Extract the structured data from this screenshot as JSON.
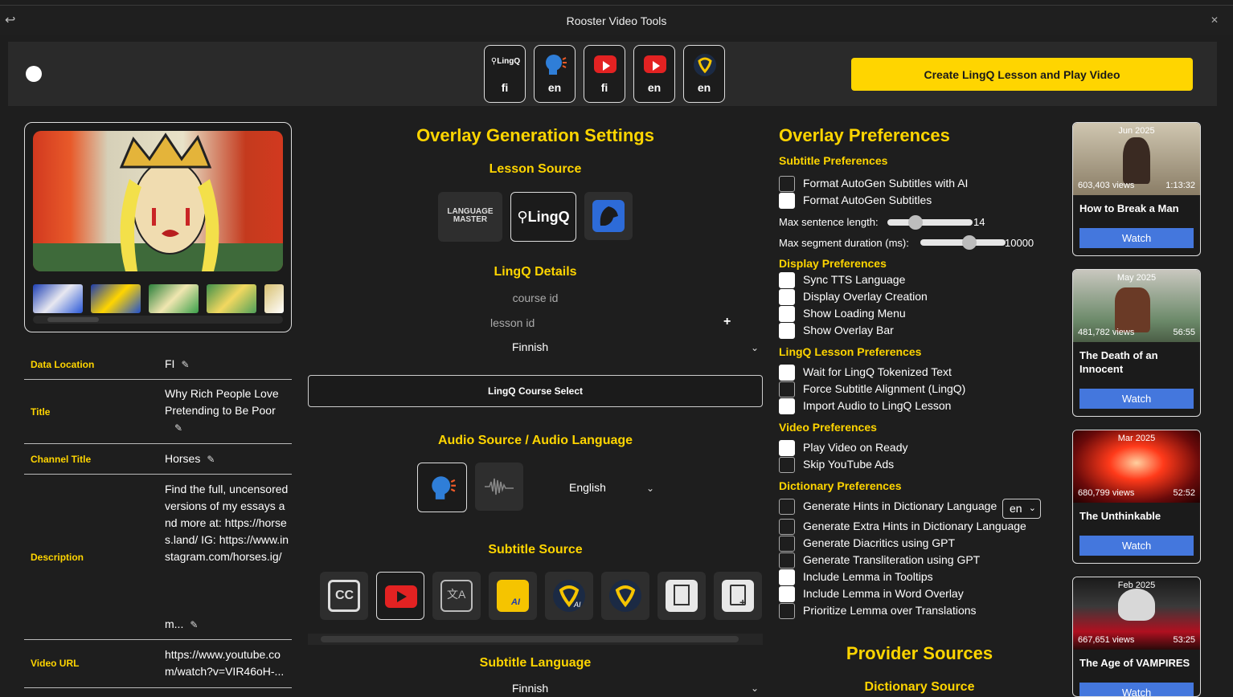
{
  "window": {
    "title": "Rooster Video Tools"
  },
  "topbar": {
    "langs": [
      {
        "icon": "lingq-logo-icon",
        "label": "fi"
      },
      {
        "icon": "speaking-head-icon",
        "label": "en"
      },
      {
        "icon": "youtube-icon",
        "label": "fi"
      },
      {
        "icon": "youtube-icon",
        "label": "en"
      },
      {
        "icon": "lingq-pin-icon",
        "label": "en"
      }
    ],
    "create_label": "Create LingQ Lesson and Play Video"
  },
  "info": {
    "data_location_k": "Data Location",
    "data_location_v": "FI",
    "title_k": "Title",
    "title_v": "Why Rich People Love Pretending to Be Poor",
    "channel_k": "Channel Title",
    "channel_v": "Horses",
    "desc_k": "Description",
    "desc_v": "Find the full, uncensored versions of my essays and more at: https://horses.land/ IG: https://www.instagram.com/horses.ig/",
    "desc_more": "m...",
    "url_k": "Video URL",
    "url_v": "https://www.youtube.com/watch?v=VIR46oH-..."
  },
  "center": {
    "heading": "Overlay Generation Settings",
    "lesson_source": "Lesson Source",
    "lm_label": "LANGUAGE MASTER",
    "lingq_label": "LingQ",
    "lingq_details": "LingQ Details",
    "course_id": "course id",
    "lesson_id": "lesson id",
    "plus": "+",
    "lesson_lang": "Finnish",
    "course_select": "LingQ Course Select",
    "audio_heading": "Audio Source / Audio Language",
    "audio_lang": "English",
    "subtitle_source": "Subtitle Source",
    "subtitle_language": "Subtitle Language",
    "subtitle_lang_val": "Finnish"
  },
  "prefs": {
    "heading": "Overlay Preferences",
    "subtitle_h": "Subtitle Preferences",
    "format_ai": "Format AutoGen Subtitles with AI",
    "format": "Format AutoGen Subtitles",
    "max_sentence": "Max sentence length:",
    "max_sentence_val": "14",
    "max_segment": "Max segment duration (ms):",
    "max_segment_val": "10000",
    "display_h": "Display Preferences",
    "sync_tts": "Sync TTS Language",
    "display_overlay": "Display Overlay Creation",
    "show_loading": "Show Loading Menu",
    "show_bar": "Show Overlay Bar",
    "lingq_h": "LingQ Lesson Preferences",
    "wait_tok": "Wait for LingQ Tokenized Text",
    "force_align": "Force Subtitle Alignment (LingQ)",
    "import_audio": "Import Audio to LingQ Lesson",
    "video_h": "Video Preferences",
    "play_ready": "Play Video on Ready",
    "skip_ads": "Skip YouTube Ads",
    "dict_h": "Dictionary Preferences",
    "gen_hints": "Generate Hints in Dictionary Language",
    "dict_lang": "en",
    "gen_extra": "Generate Extra Hints in Dictionary Language",
    "gen_diac": "Generate Diacritics using GPT",
    "gen_translit": "Generate Transliteration using GPT",
    "lemma_tooltips": "Include Lemma in Tooltips",
    "lemma_overlay": "Include Lemma in Word Overlay",
    "prioritize": "Prioritize Lemma over Translations",
    "provider_h": "Provider Sources",
    "dictionary_src": "Dictionary Source"
  },
  "videos": [
    {
      "date": "Jun 2025",
      "views": "603,403 views",
      "dur": "1:13:32",
      "title": "How to Break a Man",
      "watch": "Watch"
    },
    {
      "date": "May 2025",
      "views": "481,782 views",
      "dur": "56:55",
      "title": "The Death of an Innocent",
      "watch": "Watch"
    },
    {
      "date": "Mar 2025",
      "views": "680,799 views",
      "dur": "52:52",
      "title": "The Unthinkable",
      "watch": "Watch"
    },
    {
      "date": "Feb 2025",
      "views": "667,651 views",
      "dur": "53:25",
      "title": "The Age of VAMPIRES",
      "watch": "Watch"
    }
  ],
  "colors": {
    "accent": "#ffd500",
    "watch": "#4477dd",
    "youtube": "#e32222"
  }
}
